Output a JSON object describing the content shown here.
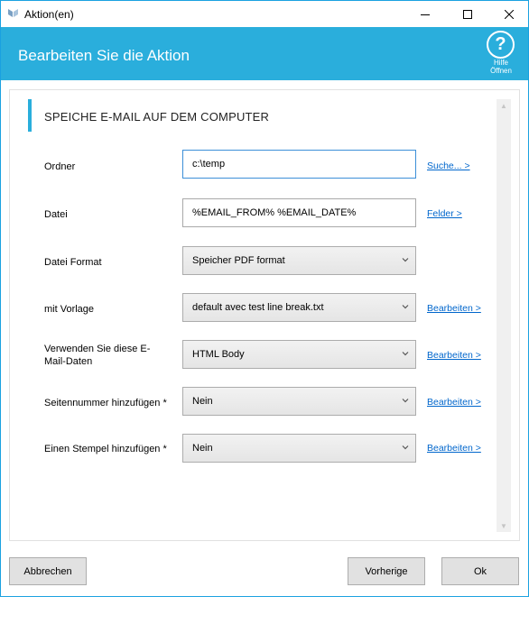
{
  "window": {
    "title": "Aktion(en)"
  },
  "header": {
    "title": "Bearbeiten Sie die Aktion",
    "help_line1": "Hilfe",
    "help_line2": "Öffnen",
    "help_symbol": "?"
  },
  "section": {
    "title": "SPEICHE E-MAIL AUF DEM COMPUTER"
  },
  "form": {
    "folder": {
      "label": "Ordner",
      "value": "c:\\temp",
      "link": "Suche... >"
    },
    "file": {
      "label": "Datei",
      "value": "%EMAIL_FROM% %EMAIL_DATE%",
      "link": "Felder >"
    },
    "file_format": {
      "label": "Datei Format",
      "value": "Speicher PDF format"
    },
    "template": {
      "label": "mit Vorlage",
      "value": "default avec test line break.txt",
      "link": "Bearbeiten >"
    },
    "email_data": {
      "label": "Verwenden Sie diese E-Mail-Daten",
      "value": "HTML Body",
      "link": "Bearbeiten >"
    },
    "page_number": {
      "label": "Seitennummer hinzufügen *",
      "value": "Nein",
      "link": "Bearbeiten >"
    },
    "stamp": {
      "label": "Einen Stempel hinzufügen *",
      "value": "Nein",
      "link": "Bearbeiten >"
    }
  },
  "footer": {
    "cancel_label": "Abbrechen",
    "previous_label": "Vorherige",
    "ok_label": "Ok"
  },
  "colors": {
    "accent": "#2aaedc",
    "link": "#0066cc"
  },
  "icons": [
    "app-icon",
    "minimize-icon",
    "maximize-icon",
    "close-icon",
    "help-icon",
    "chevron-down-icon",
    "scroll-up-icon",
    "scroll-down-icon"
  ]
}
